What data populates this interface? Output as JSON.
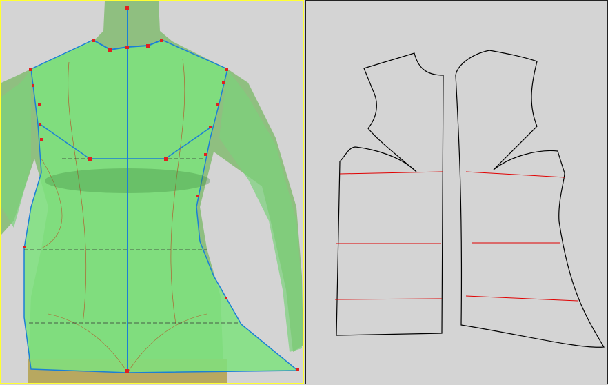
{
  "colors": {
    "active_view_border": "#ffff33",
    "background": "#d4d4d4",
    "garment_fill": "#7fe07f",
    "mannequin": "#9bc98a",
    "outline": "#1a7fd6",
    "control_point": "#e02020",
    "pattern_line": "#000000",
    "guide_line": "#e00000"
  }
}
